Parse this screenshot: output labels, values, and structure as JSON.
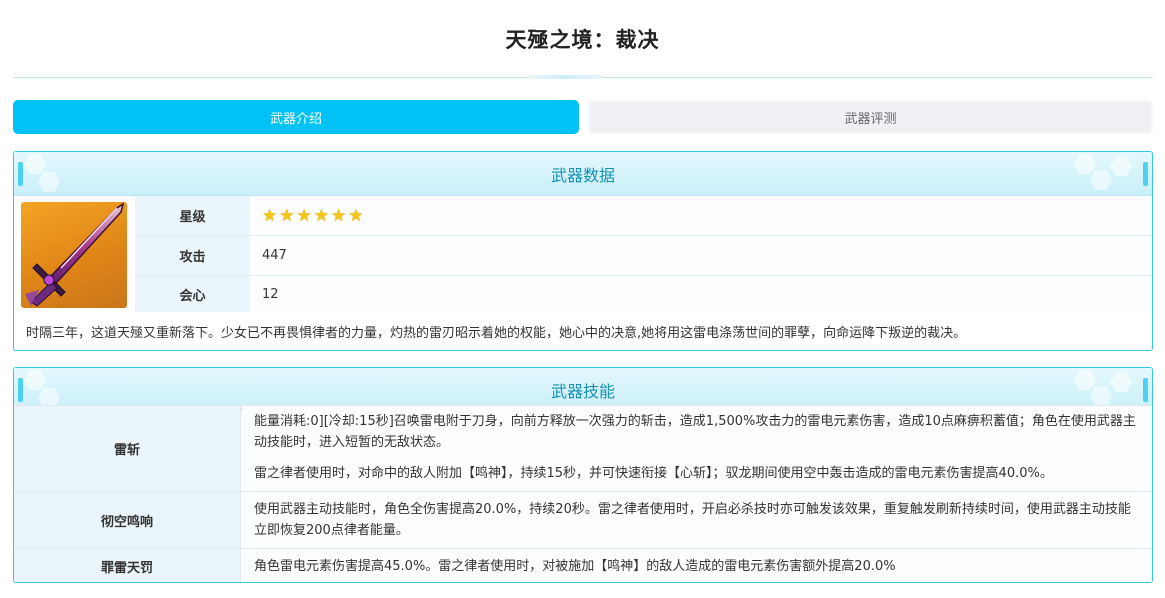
{
  "page": {
    "title": "天殛之境：裁决"
  },
  "tabs": [
    {
      "label": "武器介绍",
      "active": true
    },
    {
      "label": "武器评测",
      "active": false
    }
  ],
  "weapon_data": {
    "header": "武器数据",
    "image_icon": "weapon-sword-icon",
    "rows": [
      {
        "label": "星级",
        "stars": 6
      },
      {
        "label": "攻击",
        "value": "447"
      },
      {
        "label": "会心",
        "value": "12"
      }
    ],
    "description": "时隔三年，这道天殛又重新落下。少女已不再畏惧律者的力量，灼热的雷刃昭示着她的权能，她心中的决意,她将用这雷电涤荡世间的罪孽，向命运降下叛逆的裁决。"
  },
  "weapon_skills": {
    "header": "武器技能",
    "skills": [
      {
        "name": "雷斩",
        "paragraphs": [
          "能量消耗:0][冷却:15秒]召唤雷电附于刀身，向前方释放一次强力的斩击，造成1,500%攻击力的雷电元素伤害，造成10点麻痹积蓄值；角色在使用武器主动技能时，进入短暂的无敌状态。",
          "雷之律者使用时，对命中的敌人附加【鸣神】，持续15秒，并可快速衔接【心斩】；驭龙期间使用空中轰击造成的雷电元素伤害提高40.0%。"
        ]
      },
      {
        "name": "彻空鸣响",
        "paragraphs": [
          "使用武器主动技能时，角色全伤害提高20.0%，持续20秒。雷之律者使用时，开启必杀技时亦可触发该效果，重复触发刷新持续时间，使用武器主动技能立即恢复200点律者能量。"
        ]
      },
      {
        "name": "罪雷天罚",
        "paragraphs": [
          "角色雷电元素伤害提高45.0%。雷之律者使用时，对被施加【鸣神】的敌人造成的雷电元素伤害额外提高20.0%"
        ]
      }
    ]
  },
  "colors": {
    "accent": "#00c2f5",
    "panel_border": "#36c7e6",
    "header_text": "#1591b6",
    "label_bg": "#eaf5fb",
    "star": "#f5c518"
  }
}
